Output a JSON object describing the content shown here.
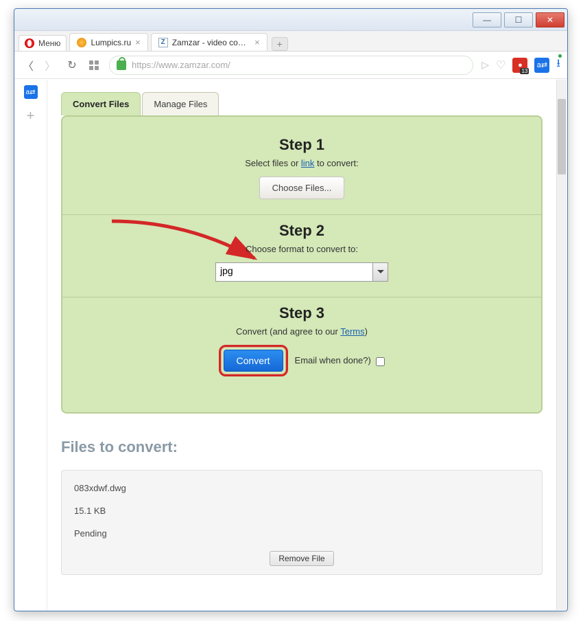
{
  "window": {
    "menu_label": "Меню"
  },
  "tabs": [
    {
      "title": "Lumpics.ru"
    },
    {
      "title": "Zamzar - video converter,"
    }
  ],
  "address": {
    "url": "https://www.zamzar.com/",
    "ext_badge": "13"
  },
  "page_tabs": {
    "active": "Convert Files",
    "other": "Manage Files"
  },
  "step1": {
    "title": "Step 1",
    "desc_before": "Select files or ",
    "link": "link",
    "desc_after": " to convert:",
    "button": "Choose Files..."
  },
  "step2": {
    "title": "Step 2",
    "desc": "Choose format to convert to:",
    "value": "jpg"
  },
  "step3": {
    "title": "Step 3",
    "desc_before": "Convert (and agree to our ",
    "terms": "Terms",
    "desc_after": ")",
    "button": "Convert",
    "email_label": "Email when done?)"
  },
  "files": {
    "heading": "Files to convert:",
    "name": "083xdwf.dwg",
    "size": "15.1 KB",
    "status": "Pending",
    "remove": "Remove File"
  }
}
